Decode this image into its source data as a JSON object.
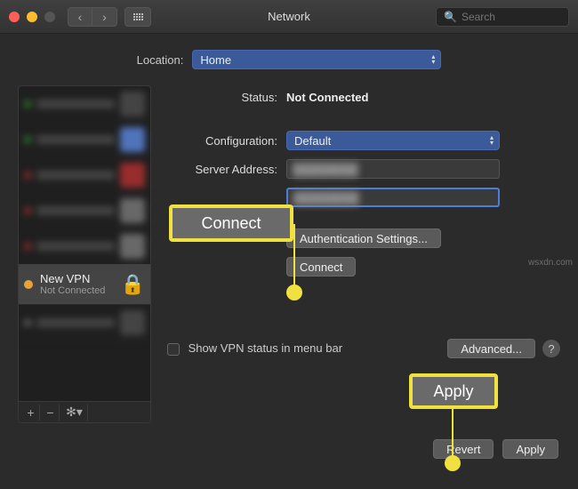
{
  "window": {
    "title": "Network"
  },
  "search": {
    "placeholder": "Search"
  },
  "location": {
    "label": "Location:",
    "value": "Home"
  },
  "sidebar": {
    "vpn": {
      "name": "New VPN",
      "status": "Not Connected"
    },
    "footer": {
      "add": "+",
      "remove": "−",
      "gear": "✻▾"
    }
  },
  "main": {
    "status_label": "Status:",
    "status_value": "Not Connected",
    "config_label": "Configuration:",
    "config_value": "Default",
    "server_label": "Server Address:",
    "auth_button": "Authentication Settings...",
    "connect_button": "Connect",
    "show_menubar": "Show VPN status in menu bar",
    "advanced": "Advanced...",
    "help": "?"
  },
  "bottom": {
    "revert": "Revert",
    "apply": "Apply"
  },
  "callouts": {
    "connect": "Connect",
    "apply": "Apply"
  },
  "watermark": "wsxdn.com"
}
